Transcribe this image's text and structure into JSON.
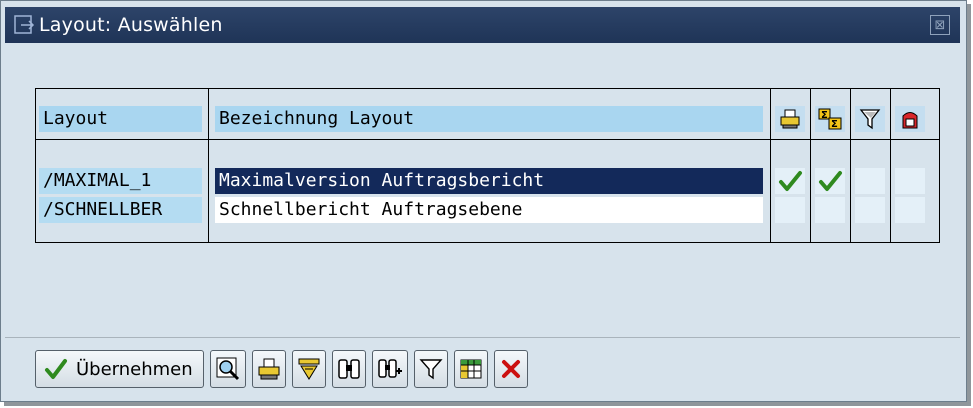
{
  "dialog": {
    "title": "Layout: Auswählen",
    "close_glyph": "⊠"
  },
  "table": {
    "headers": {
      "layout": "Layout",
      "description": "Bezeichnung Layout"
    },
    "flag_headers": [
      "print-icon",
      "sum-icon",
      "filter-icon",
      "ink-icon"
    ],
    "rows": [
      {
        "layout": "/MAXIMAL_1",
        "description": "Maximalversion Auftragsbericht",
        "selected": true,
        "flags": [
          true,
          true,
          false,
          false
        ]
      },
      {
        "layout": "/SCHNELLBER",
        "description": "Schnellbericht Auftragsebene",
        "selected": false,
        "flags": [
          false,
          false,
          false,
          false
        ]
      }
    ]
  },
  "toolbar": {
    "accept_label": "Übernehmen",
    "buttons": [
      "details-icon",
      "print-icon",
      "sort-icon",
      "find-icon",
      "find-next-icon",
      "filter-icon",
      "spreadsheet-icon",
      "cancel-icon"
    ]
  },
  "colors": {
    "title_bar": "#1f3457",
    "background": "#d7e3ec",
    "header_cell": "#a9d6f0",
    "selected_row": "#13295a",
    "check_green": "#2f8a1f",
    "cancel_red": "#cc1010"
  }
}
